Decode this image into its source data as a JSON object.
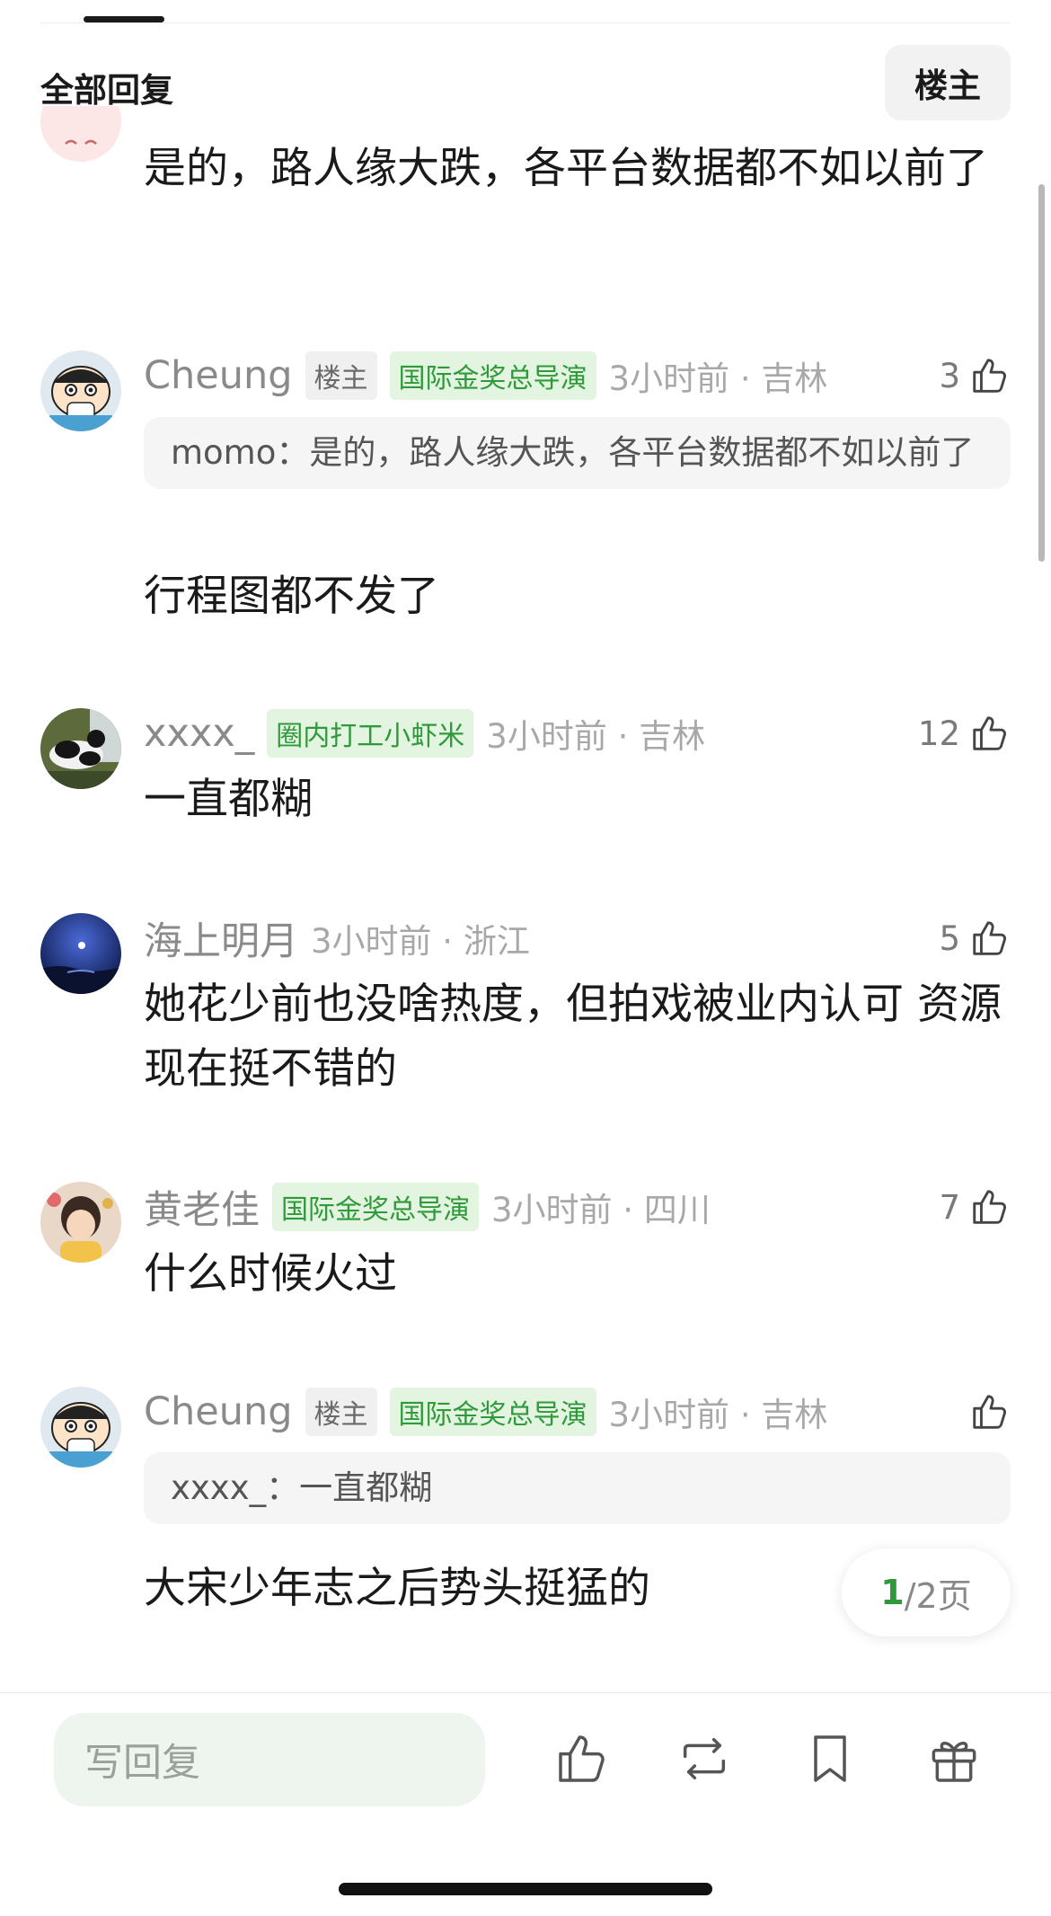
{
  "header": {
    "title": "全部回复",
    "owner_filter": "楼主"
  },
  "colors": {
    "accent_green": "#2f9a3a",
    "tag_green_bg": "#e3f4e1",
    "text_gray": "#8a8a8a"
  },
  "first_comment_tail": {
    "text": "是的，路人缘大跌，各平台数据都不如以前了"
  },
  "comments": [
    {
      "username": "Cheung",
      "owner_tag": "楼主",
      "badge": "国际金奖总导演",
      "time": "3小时前 · 吉林",
      "likes": "3",
      "quote": "momo：是的，路人缘大跌，各平台数据都不如以前了",
      "text": "行程图都不发了"
    },
    {
      "username": "xxxx_",
      "badge": "圈内打工小虾米",
      "time": "3小时前 · 吉林",
      "likes": "12",
      "text": "一直都糊"
    },
    {
      "username": "海上明月",
      "time": "3小时前 · 浙江",
      "likes": "5",
      "text": "她花少前也没啥热度，但拍戏被业内认可  资源现在挺不错的"
    },
    {
      "username": "黄老佳",
      "badge": "国际金奖总导演",
      "time": "3小时前 · 四川",
      "likes": "7",
      "text": "什么时候火过"
    },
    {
      "username": "Cheung",
      "owner_tag": "楼主",
      "badge": "国际金奖总导演",
      "time": "3小时前 · 吉林",
      "likes": "",
      "quote": "xxxx_：一直都糊",
      "text": "大宋少年志之后势头挺猛的"
    }
  ],
  "pagination": {
    "current": "1",
    "total": "/2页"
  },
  "bottom_bar": {
    "reply_placeholder": "写回复",
    "actions": [
      "like-icon",
      "repost-icon",
      "bookmark-icon",
      "gift-icon"
    ]
  }
}
